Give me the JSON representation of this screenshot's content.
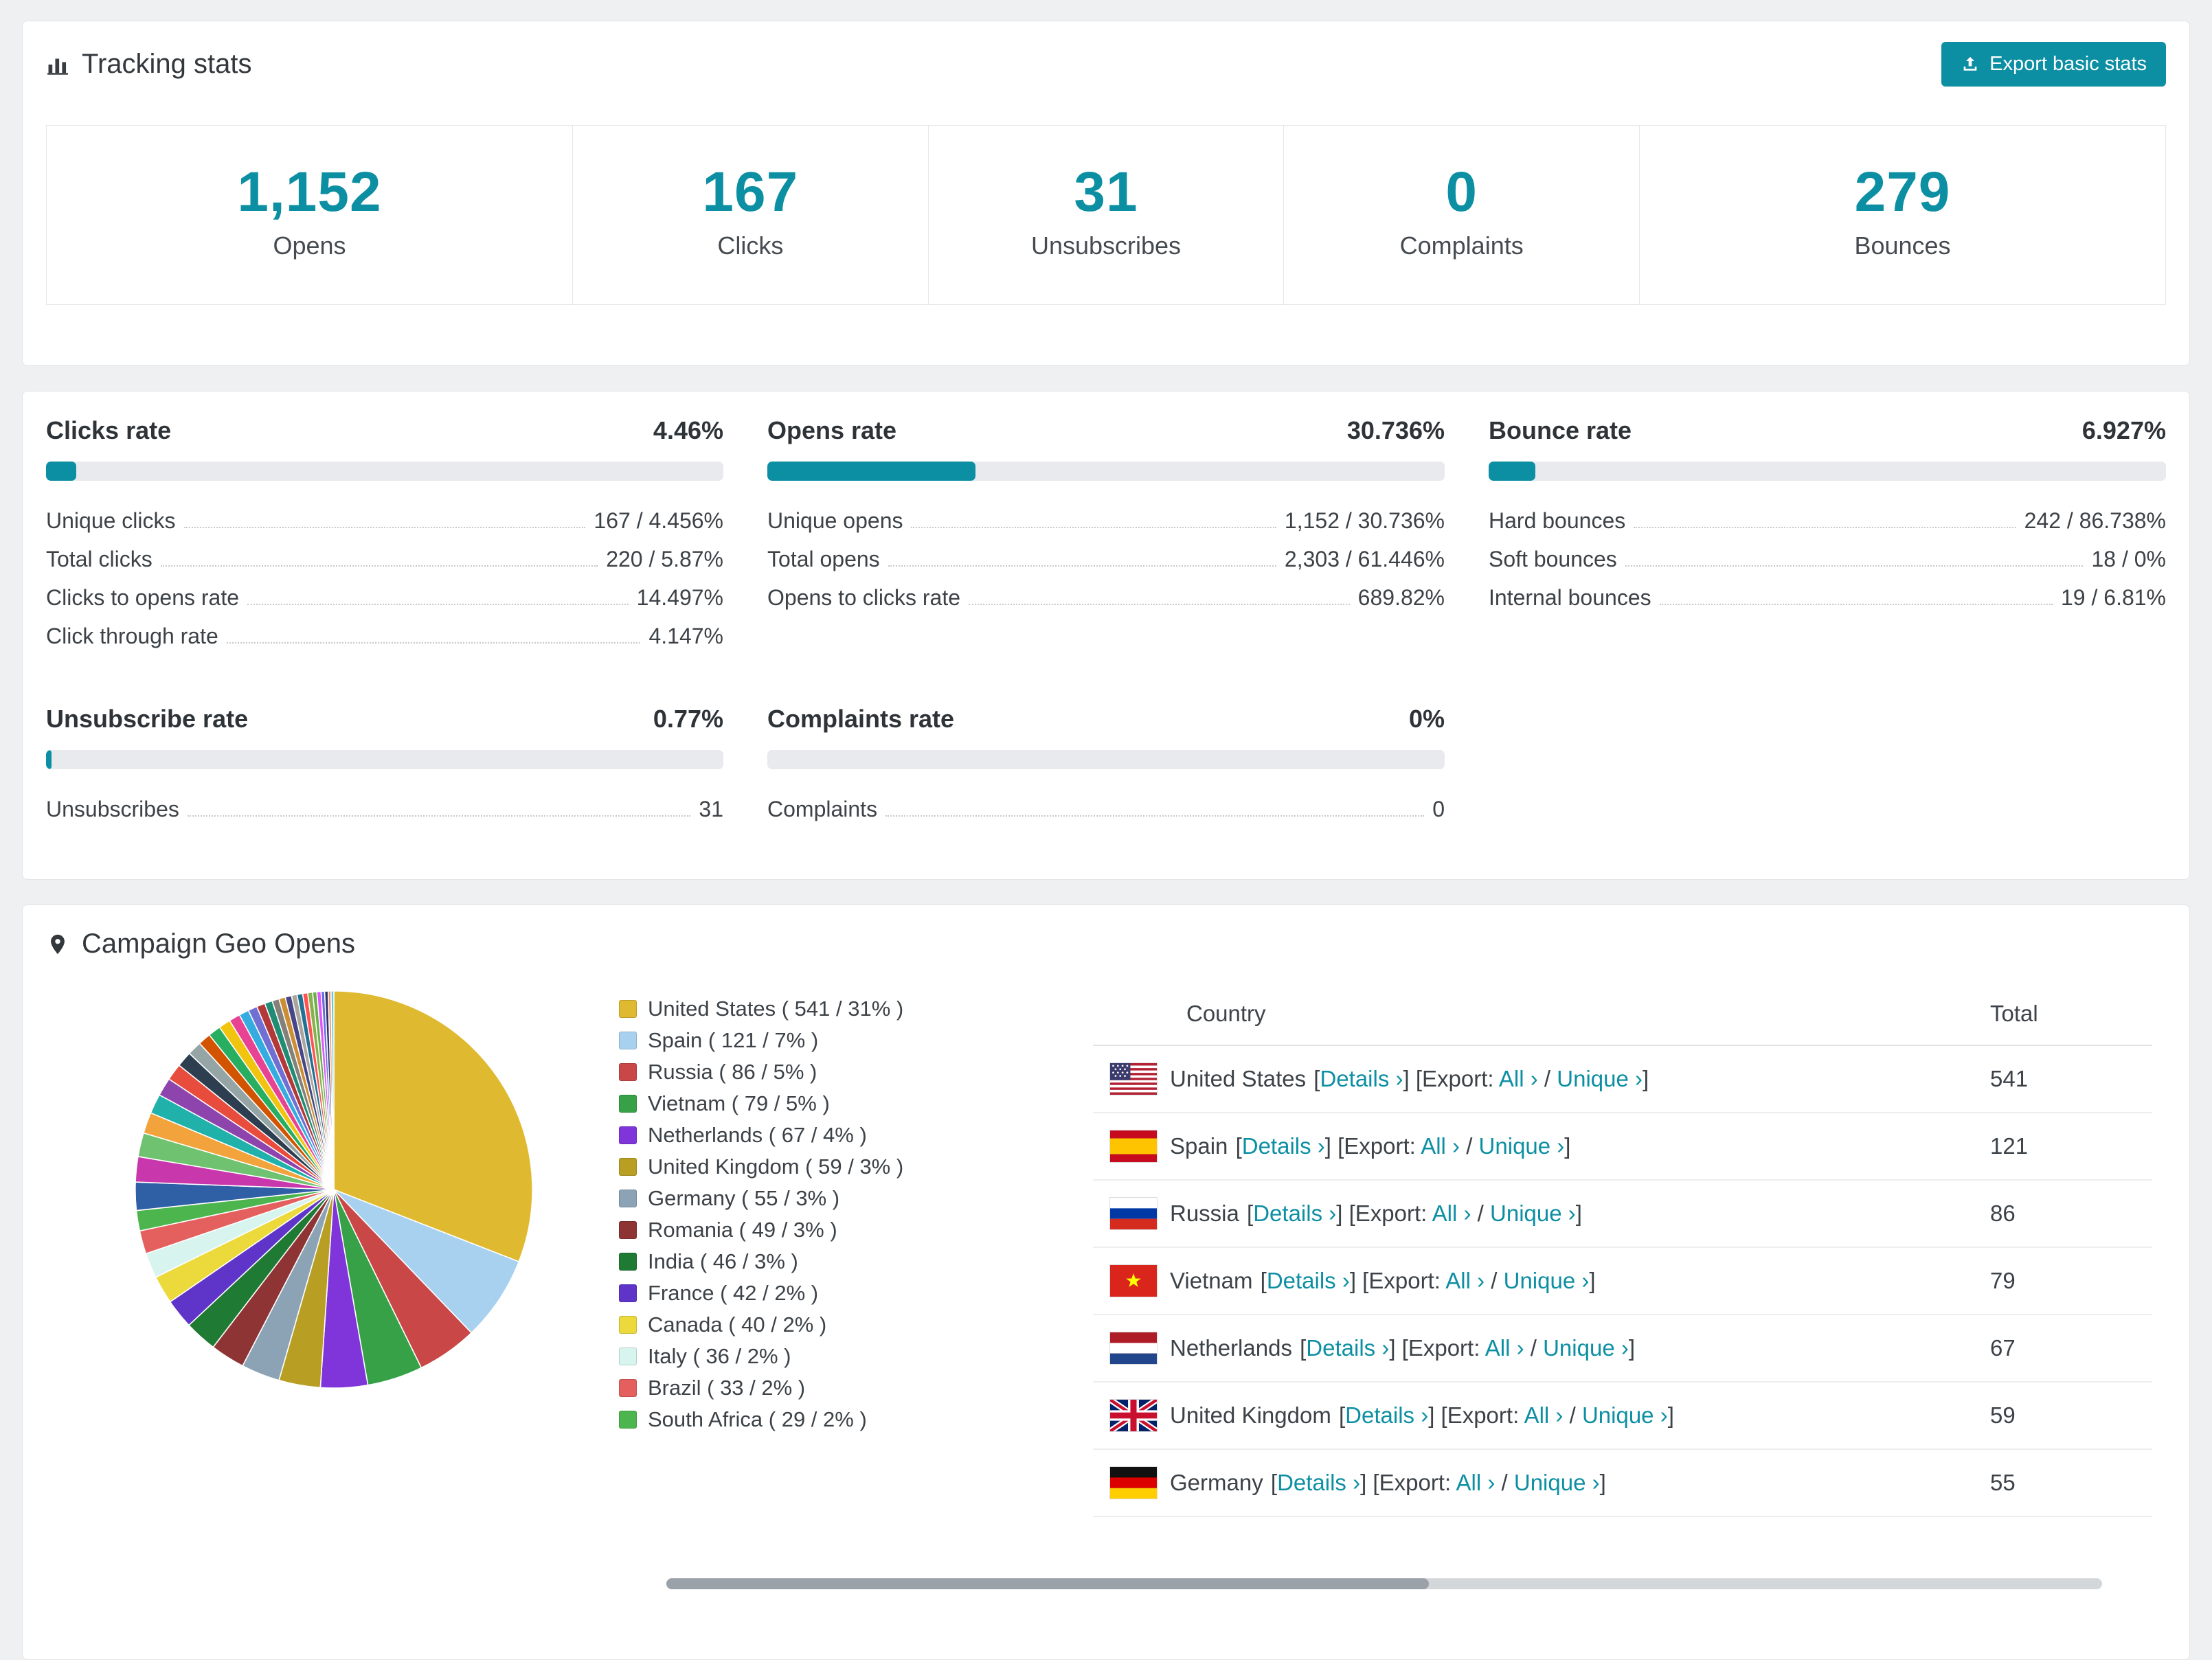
{
  "accent_color": "#0d8fa3",
  "tracking": {
    "title": "Tracking stats",
    "export_label": "Export basic stats",
    "stats": [
      {
        "value": "1,152",
        "label": "Opens"
      },
      {
        "value": "167",
        "label": "Clicks"
      },
      {
        "value": "31",
        "label": "Unsubscribes"
      },
      {
        "value": "0",
        "label": "Complaints"
      },
      {
        "value": "279",
        "label": "Bounces"
      }
    ]
  },
  "rates": [
    {
      "title": "Clicks rate",
      "value": "4.46%",
      "percent": 4.46,
      "rows": [
        {
          "label": "Unique clicks",
          "value": "167 / 4.456%"
        },
        {
          "label": "Total clicks",
          "value": "220 / 5.87%"
        },
        {
          "label": "Clicks to opens rate",
          "value": "14.497%"
        },
        {
          "label": "Click through rate",
          "value": "4.147%"
        }
      ]
    },
    {
      "title": "Opens rate",
      "value": "30.736%",
      "percent": 30.736,
      "rows": [
        {
          "label": "Unique opens",
          "value": "1,152 / 30.736%"
        },
        {
          "label": "Total opens",
          "value": "2,303 / 61.446%"
        },
        {
          "label": "Opens to clicks rate",
          "value": "689.82%"
        }
      ]
    },
    {
      "title": "Bounce rate",
      "value": "6.927%",
      "percent": 6.927,
      "rows": [
        {
          "label": "Hard bounces",
          "value": "242 / 86.738%"
        },
        {
          "label": "Soft bounces",
          "value": "18 / 0%"
        },
        {
          "label": "Internal bounces",
          "value": "19 / 6.81%"
        }
      ]
    },
    {
      "title": "Unsubscribe rate",
      "value": "0.77%",
      "percent": 0.77,
      "rows": [
        {
          "label": "Unsubscribes",
          "value": "31"
        }
      ]
    },
    {
      "title": "Complaints rate",
      "value": "0%",
      "percent": 0,
      "rows": [
        {
          "label": "Complaints",
          "value": "0"
        }
      ]
    }
  ],
  "geo": {
    "title": "Campaign Geo Opens",
    "legend": [
      {
        "name": "United States",
        "value": 541,
        "percent": 31,
        "color": "#dfb92f"
      },
      {
        "name": "Spain",
        "value": 121,
        "percent": 7,
        "color": "#a8d1f0"
      },
      {
        "name": "Russia",
        "value": 86,
        "percent": 5,
        "color": "#c94747"
      },
      {
        "name": "Vietnam",
        "value": 79,
        "percent": 5,
        "color": "#36a147"
      },
      {
        "name": "Netherlands",
        "value": 67,
        "percent": 4,
        "color": "#7f35d9"
      },
      {
        "name": "United Kingdom",
        "value": 59,
        "percent": 3,
        "color": "#b89f24"
      },
      {
        "name": "Germany",
        "value": 55,
        "percent": 3,
        "color": "#8ba3b5"
      },
      {
        "name": "Romania",
        "value": 49,
        "percent": 3,
        "color": "#8e3434"
      },
      {
        "name": "India",
        "value": 46,
        "percent": 3,
        "color": "#1f7a33"
      },
      {
        "name": "France",
        "value": 42,
        "percent": 2,
        "color": "#5e35c8"
      },
      {
        "name": "Canada",
        "value": 40,
        "percent": 2,
        "color": "#ecd93c"
      },
      {
        "name": "Italy",
        "value": 36,
        "percent": 2,
        "color": "#d7f4ee"
      },
      {
        "name": "Brazil",
        "value": 33,
        "percent": 2,
        "color": "#e4605f"
      },
      {
        "name": "South Africa",
        "value": 29,
        "percent": 2,
        "color": "#4db54d"
      }
    ],
    "table": {
      "headers": [
        "Country",
        "Total"
      ],
      "links": {
        "bracket_open": "[",
        "bracket_close": "]",
        "details": "Details ›",
        "export_prefix": "[Export:",
        "all": "All ›",
        "separator": "/",
        "unique": "Unique ›"
      },
      "rows": [
        {
          "name": "United States",
          "flag": "us",
          "total": "541"
        },
        {
          "name": "Spain",
          "flag": "es",
          "total": "121"
        },
        {
          "name": "Russia",
          "flag": "ru",
          "total": "86"
        },
        {
          "name": "Vietnam",
          "flag": "vn",
          "total": "79"
        },
        {
          "name": "Netherlands",
          "flag": "nl",
          "total": "67"
        },
        {
          "name": "United Kingdom",
          "flag": "gb",
          "total": "59"
        },
        {
          "name": "Germany",
          "flag": "de",
          "total": "55"
        }
      ]
    }
  },
  "chart_data": {
    "type": "pie",
    "title": "Campaign Geo Opens",
    "legend_position": "right",
    "labels": [
      "United States",
      "Spain",
      "Russia",
      "Vietnam",
      "Netherlands",
      "United Kingdom",
      "Germany",
      "Romania",
      "India",
      "France",
      "Canada",
      "Italy",
      "Brazil",
      "South Africa"
    ],
    "values": [
      541,
      121,
      86,
      79,
      67,
      59,
      55,
      49,
      46,
      42,
      40,
      36,
      33,
      29
    ],
    "percents": [
      31,
      7,
      5,
      5,
      4,
      3,
      3,
      3,
      3,
      2,
      2,
      2,
      2,
      2
    ],
    "colors": [
      "#dfb92f",
      "#a8d1f0",
      "#c94747",
      "#36a147",
      "#7f35d9",
      "#b89f24",
      "#8ba3b5",
      "#8e3434",
      "#1f7a33",
      "#5e35c8",
      "#ecd93c",
      "#d7f4ee",
      "#e4605f",
      "#4db54d"
    ],
    "others": {
      "values": [
        40,
        36,
        34,
        30,
        28,
        26,
        24,
        22,
        20,
        18,
        18,
        17,
        16,
        14,
        13,
        12,
        11,
        10,
        9,
        9,
        8,
        8,
        7,
        7,
        6,
        6,
        5,
        5,
        4,
        4
      ],
      "colors": [
        "#2f5fa5",
        "#c837ab",
        "#6fc26f",
        "#f2a33c",
        "#20b2aa",
        "#8e44ad",
        "#e74c3c",
        "#2c3e50",
        "#95a5a6",
        "#d35400",
        "#27ae60",
        "#f1c40f",
        "#e84393",
        "#34ace0",
        "#706fd3",
        "#b33939",
        "#218c74",
        "#84817a",
        "#cc8e35",
        "#474787",
        "#aaa69d",
        "#227093",
        "#ff5252",
        "#88b04b",
        "#6ab04c",
        "#e056fd",
        "#686de0",
        "#30336b",
        "#f19066",
        "#63cdda"
      ]
    }
  }
}
